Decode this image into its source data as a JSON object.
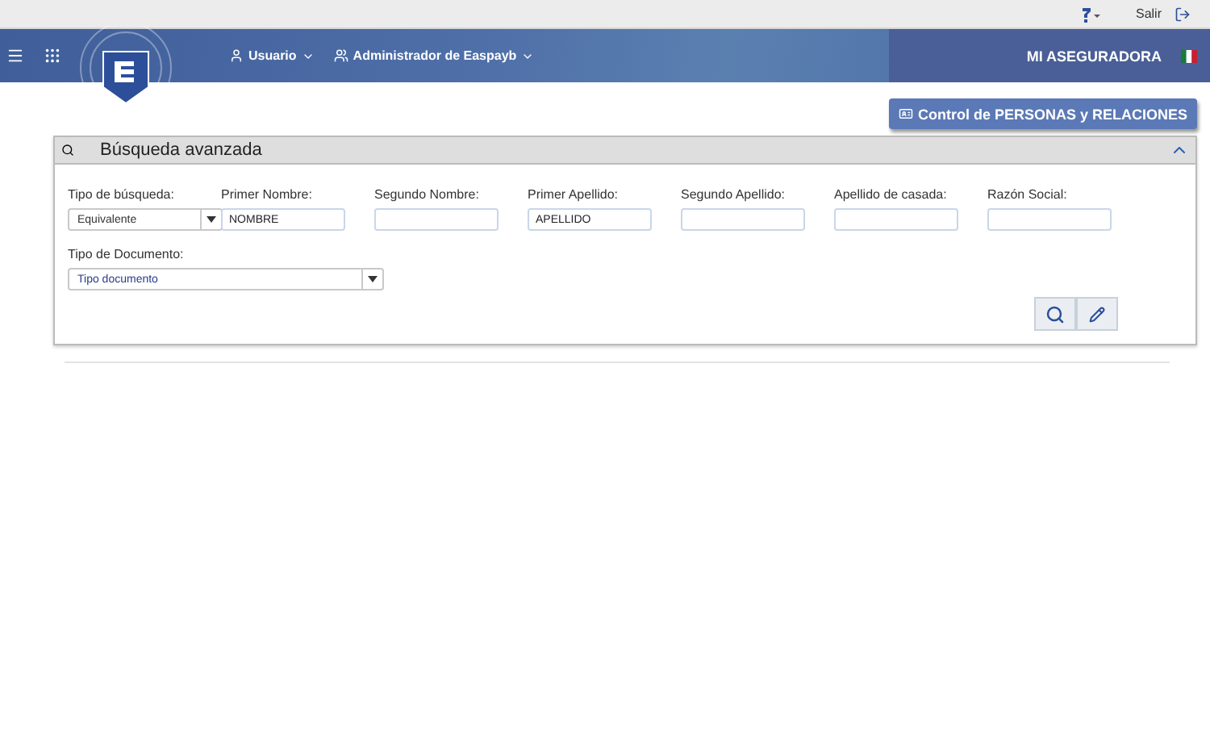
{
  "top_bar": {
    "logout": "Salir"
  },
  "header": {
    "menus": [
      {
        "label": "Usuario"
      },
      {
        "label": "Administrador de Easpayb"
      }
    ],
    "company": "MI ASEGURADORA"
  },
  "actions": {
    "control_button": "Control de PERSONAS y RELACIONES"
  },
  "panel": {
    "title": "Búsqueda avanzada",
    "expanded": true,
    "fields": [
      {
        "kind": "select",
        "label": "Tipo de búsqueda:",
        "value": "Equivalente"
      },
      {
        "kind": "input",
        "label": "Primer Nombre:",
        "value": "NOMBRE"
      },
      {
        "kind": "input",
        "label": "Segundo Nombre:"
      },
      {
        "kind": "input",
        "label": "Primer Apellido:",
        "value": "APELLIDO"
      },
      {
        "kind": "input",
        "label": "Segundo Apellido:"
      },
      {
        "kind": "input",
        "label": "Apellido de casada:"
      },
      {
        "kind": "input",
        "label": "Razón Social:"
      },
      {
        "kind": "wideselect",
        "label": "Tipo de Documento:",
        "value": "Tipo documento"
      }
    ]
  }
}
